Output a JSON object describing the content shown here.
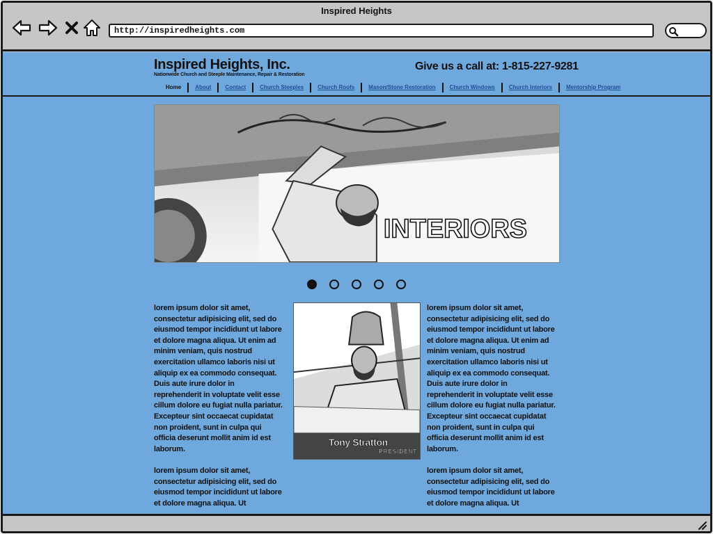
{
  "window": {
    "title": "Inspired Heights"
  },
  "browser": {
    "url": "http://inspiredheights.com",
    "back_icon": "back-arrow-icon",
    "forward_icon": "forward-arrow-icon",
    "stop_icon": "close-icon",
    "home_icon": "home-icon",
    "search_icon": "search-icon"
  },
  "site": {
    "name": "Inspired Heights, Inc.",
    "tagline": "Nationwide Church and Steeple Maintenance, Repair & Restoration",
    "phone_label": "Give us a call at:",
    "phone_number": "1-815-227-9281",
    "nav": [
      {
        "label": "Home",
        "current": true
      },
      {
        "label": "About"
      },
      {
        "label": "Contact"
      },
      {
        "label": "Church Steeples"
      },
      {
        "label": "Church Roofs"
      },
      {
        "label": "Mason/Stone Restoration"
      },
      {
        "label": "Church Windows"
      },
      {
        "label": "Church Interiors"
      },
      {
        "label": "Mentorship Program"
      }
    ]
  },
  "hero": {
    "overlay_text": "INTERIORS",
    "slide_count": 5,
    "active_slide": 1
  },
  "content": {
    "left_paragraphs": [
      "lorem ipsum dolor sit amet, consectetur adipisicing elit, sed do eiusmod tempor incididunt ut labore et dolore magna aliqua. Ut enim ad minim veniam, quis nostrud exercitation ullamco laboris nisi ut aliquip ex ea commodo consequat. Duis aute irure dolor in reprehenderit in voluptate velit esse cillum dolore eu fugiat nulla pariatur. Excepteur sint occaecat cupidatat non proident, sunt in culpa qui officia deserunt mollit anim id est laborum.",
      "lorem ipsum dolor sit amet, consectetur adipisicing elit, sed do eiusmod tempor incididunt ut labore et dolore magna aliqua. Ut"
    ],
    "right_paragraphs": [
      "lorem ipsum dolor sit amet, consectetur adipisicing elit, sed do eiusmod tempor incididunt ut labore et dolore magna aliqua. Ut enim ad minim veniam, quis nostrud exercitation ullamco laboris nisi ut aliquip ex ea commodo consequat. Duis aute irure dolor in reprehenderit in voluptate velit esse cillum dolore eu fugiat nulla pariatur. Excepteur sint occaecat cupidatat non proident, sunt in culpa qui officia deserunt mollit anim id est laborum.",
      "lorem ipsum dolor sit amet, consectetur adipisicing elit, sed do eiusmod tempor incididunt ut labore et dolore magna aliqua. Ut"
    ],
    "portrait": {
      "name": "Tony Stratton",
      "role": "PRESIDENT"
    }
  },
  "colors": {
    "page_background": "#6fa8dc",
    "chrome": "#c6c6c6",
    "link": "#1f4e96"
  }
}
